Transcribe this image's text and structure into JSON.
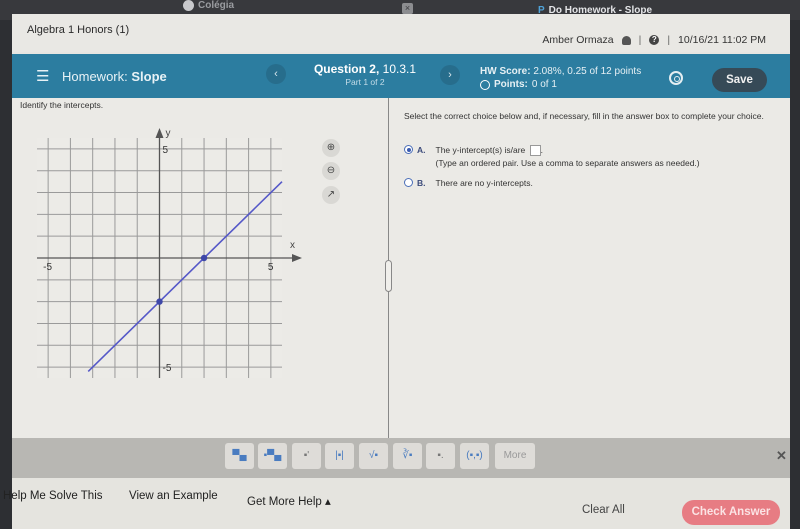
{
  "browser": {
    "tab_left": "Colégia",
    "tab_close": "×",
    "tab_right_icon": "P",
    "tab_right": "Do Homework - Slope"
  },
  "course": {
    "title": "Algebra 1 Honors (1)",
    "user_name": "Amber Ormaza",
    "separator": "|",
    "help": "?",
    "datetime": "10/16/21 11:02 PM"
  },
  "header": {
    "menu_icon": "☰",
    "homework_label": "Homework:",
    "homework_name": "Slope",
    "prev": "‹",
    "next": "›",
    "question_label": "Question 2,",
    "question_number": "10.3.1",
    "part": "Part 1 of 2",
    "hw_score_label": "HW Score:",
    "hw_score_value": "2.08%, 0.25 of 12 points",
    "points_label": "Points:",
    "points_value": "0 of 1",
    "save_label": "Save"
  },
  "question": {
    "instruction": "Identify the intercepts.",
    "prompt": "Select the correct choice below and, if necessary, fill in the answer box to complete your choice.",
    "choices": [
      {
        "letter": "A.",
        "text": "The y-intercept(s) is/are",
        "hint": "(Type an ordered pair.  Use a comma to separate answers as needed.)",
        "selected": true
      },
      {
        "letter": "B.",
        "text": "There are no y-intercepts.",
        "selected": false
      }
    ],
    "answer_value": ""
  },
  "graph_tools": {
    "zoom_in": "⊕",
    "zoom_out": "⊖",
    "popout": "↗"
  },
  "chart_data": {
    "type": "line",
    "title": "",
    "xlabel": "x",
    "ylabel": "y",
    "xlim": [
      -5.5,
      5.5
    ],
    "ylim": [
      -5.5,
      5.5
    ],
    "grid": true,
    "tick_labels": {
      "x": [
        "-5",
        "5"
      ],
      "y": [
        "5",
        "-5"
      ]
    },
    "line": {
      "slope": 1,
      "intercept": -2,
      "color": "#5558c8"
    },
    "points": [
      {
        "x": 0,
        "y": -2
      },
      {
        "x": 2,
        "y": 0
      }
    ]
  },
  "toolbar": {
    "buttons": [
      "▀▄",
      "▪▀▄",
      "▪'",
      "|▪|",
      "√▪",
      "∛▪",
      "▪.",
      "(▪,▪)"
    ],
    "more_label": "More",
    "close": "✕"
  },
  "footer": {
    "help_me_solve": "Help Me Solve This",
    "view_example": "View an Example",
    "get_more_help": "Get More Help ▴",
    "clear_all": "Clear All",
    "check_answer": "Check Answer"
  }
}
